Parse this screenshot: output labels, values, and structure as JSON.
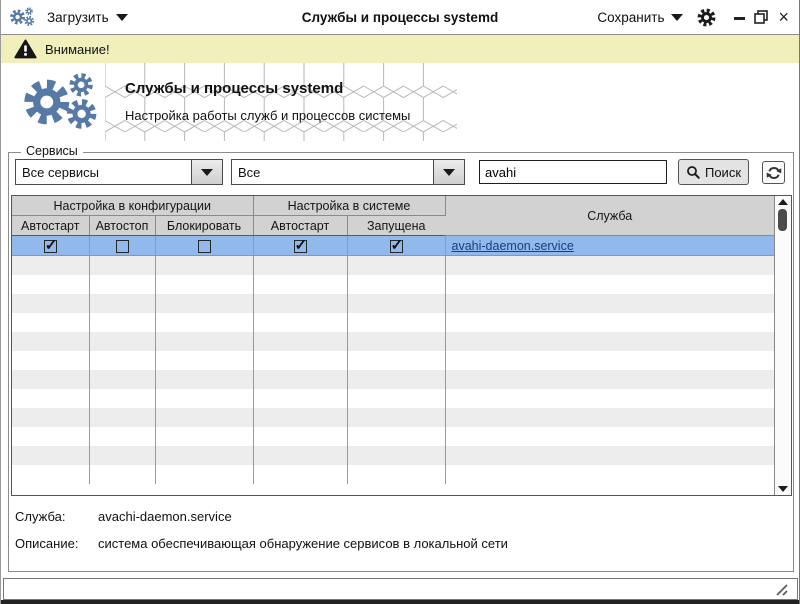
{
  "window": {
    "title": "Службы и процессы systemd",
    "menu_load": "Загрузить",
    "menu_save": "Сохранить"
  },
  "warning": {
    "text": "Внимание!"
  },
  "banner": {
    "title": "Службы и процессы systemd",
    "subtitle": "Настройка работы служб и процессов системы"
  },
  "services_group": {
    "legend": "Сервисы",
    "filter_service_value": "Все сервисы",
    "filter_state_value": "Все",
    "search_value": "avahi",
    "search_button_label": "Поиск",
    "table": {
      "group_headers": [
        "Настройка в конфигурации",
        "Настройка в системе",
        "Служба"
      ],
      "columns": [
        "Автостарт",
        "Автостоп",
        "Блокировать",
        "Автостарт",
        "Запущена"
      ],
      "rows": [
        {
          "autostart_config": true,
          "autostop": false,
          "block": false,
          "autostart_system": true,
          "running": true,
          "service": "avahi-daemon.service",
          "selected": true
        }
      ],
      "empty_filler_rows": 12
    },
    "details": {
      "service_label": "Служба:",
      "service_value": "avachi-daemon.service",
      "description_label": "Описание:",
      "description_value": "система обеспечивающая обнаружение сервисов в локальной сети"
    }
  },
  "icons": {
    "close_glyph": "×",
    "check_glyph": "✓",
    "app_logo": "three-blue-gears",
    "settings": "black-gear",
    "warning": "black-triangle-exclamation",
    "search": "magnifier",
    "refresh": "circular-arrows"
  },
  "colors": {
    "accent_blue": "#567aa5",
    "selection_blue": "#92b9ec",
    "link_blue": "#16407e",
    "warning_bg": "#f1efbc",
    "header_gray": "#d2d2d2",
    "stripe_gray": "#ededed"
  }
}
